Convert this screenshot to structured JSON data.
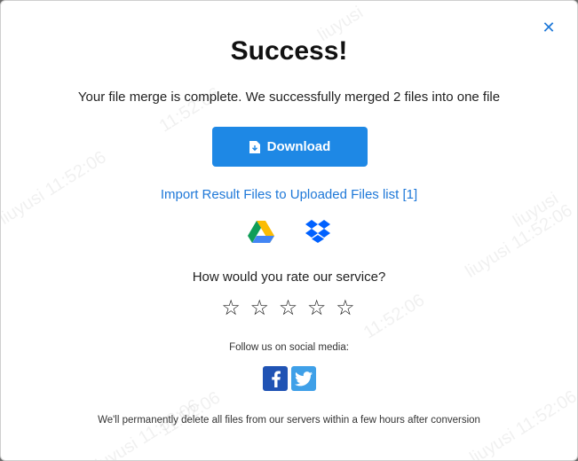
{
  "modal": {
    "title": "Success!",
    "message": "Your file merge is complete. We successfully merged 2 files into one file",
    "download_label": "Download",
    "import_link": "Import Result Files to Uploaded Files list [1]",
    "rate_question": "How would you rate our service?",
    "stars": [
      "☆",
      "☆",
      "☆",
      "☆",
      "☆"
    ],
    "follow_label": "Follow us on social media:",
    "footer_note": "We'll permanently delete all files from our servers within a few hours after conversion",
    "close_glyph": "✕"
  },
  "watermarks": [
    "liuyusi",
    "11:52:06",
    "liuyusi 11:52:06",
    "liuyusi 11:52:06",
    "11:52:06",
    "liuyusi 11:52:06",
    "liuyusi",
    "11:52:06",
    "liuyusi 11:52:06"
  ],
  "icons": {
    "close": "close-icon",
    "download": "file-download-icon",
    "cloud": [
      "google-drive-icon",
      "dropbox-icon"
    ],
    "social": [
      "facebook-icon",
      "twitter-icon"
    ]
  },
  "colors": {
    "accent": "#1e88e5",
    "link": "#1e78d8",
    "facebook": "#2053b4",
    "twitter": "#3fa0e8"
  }
}
